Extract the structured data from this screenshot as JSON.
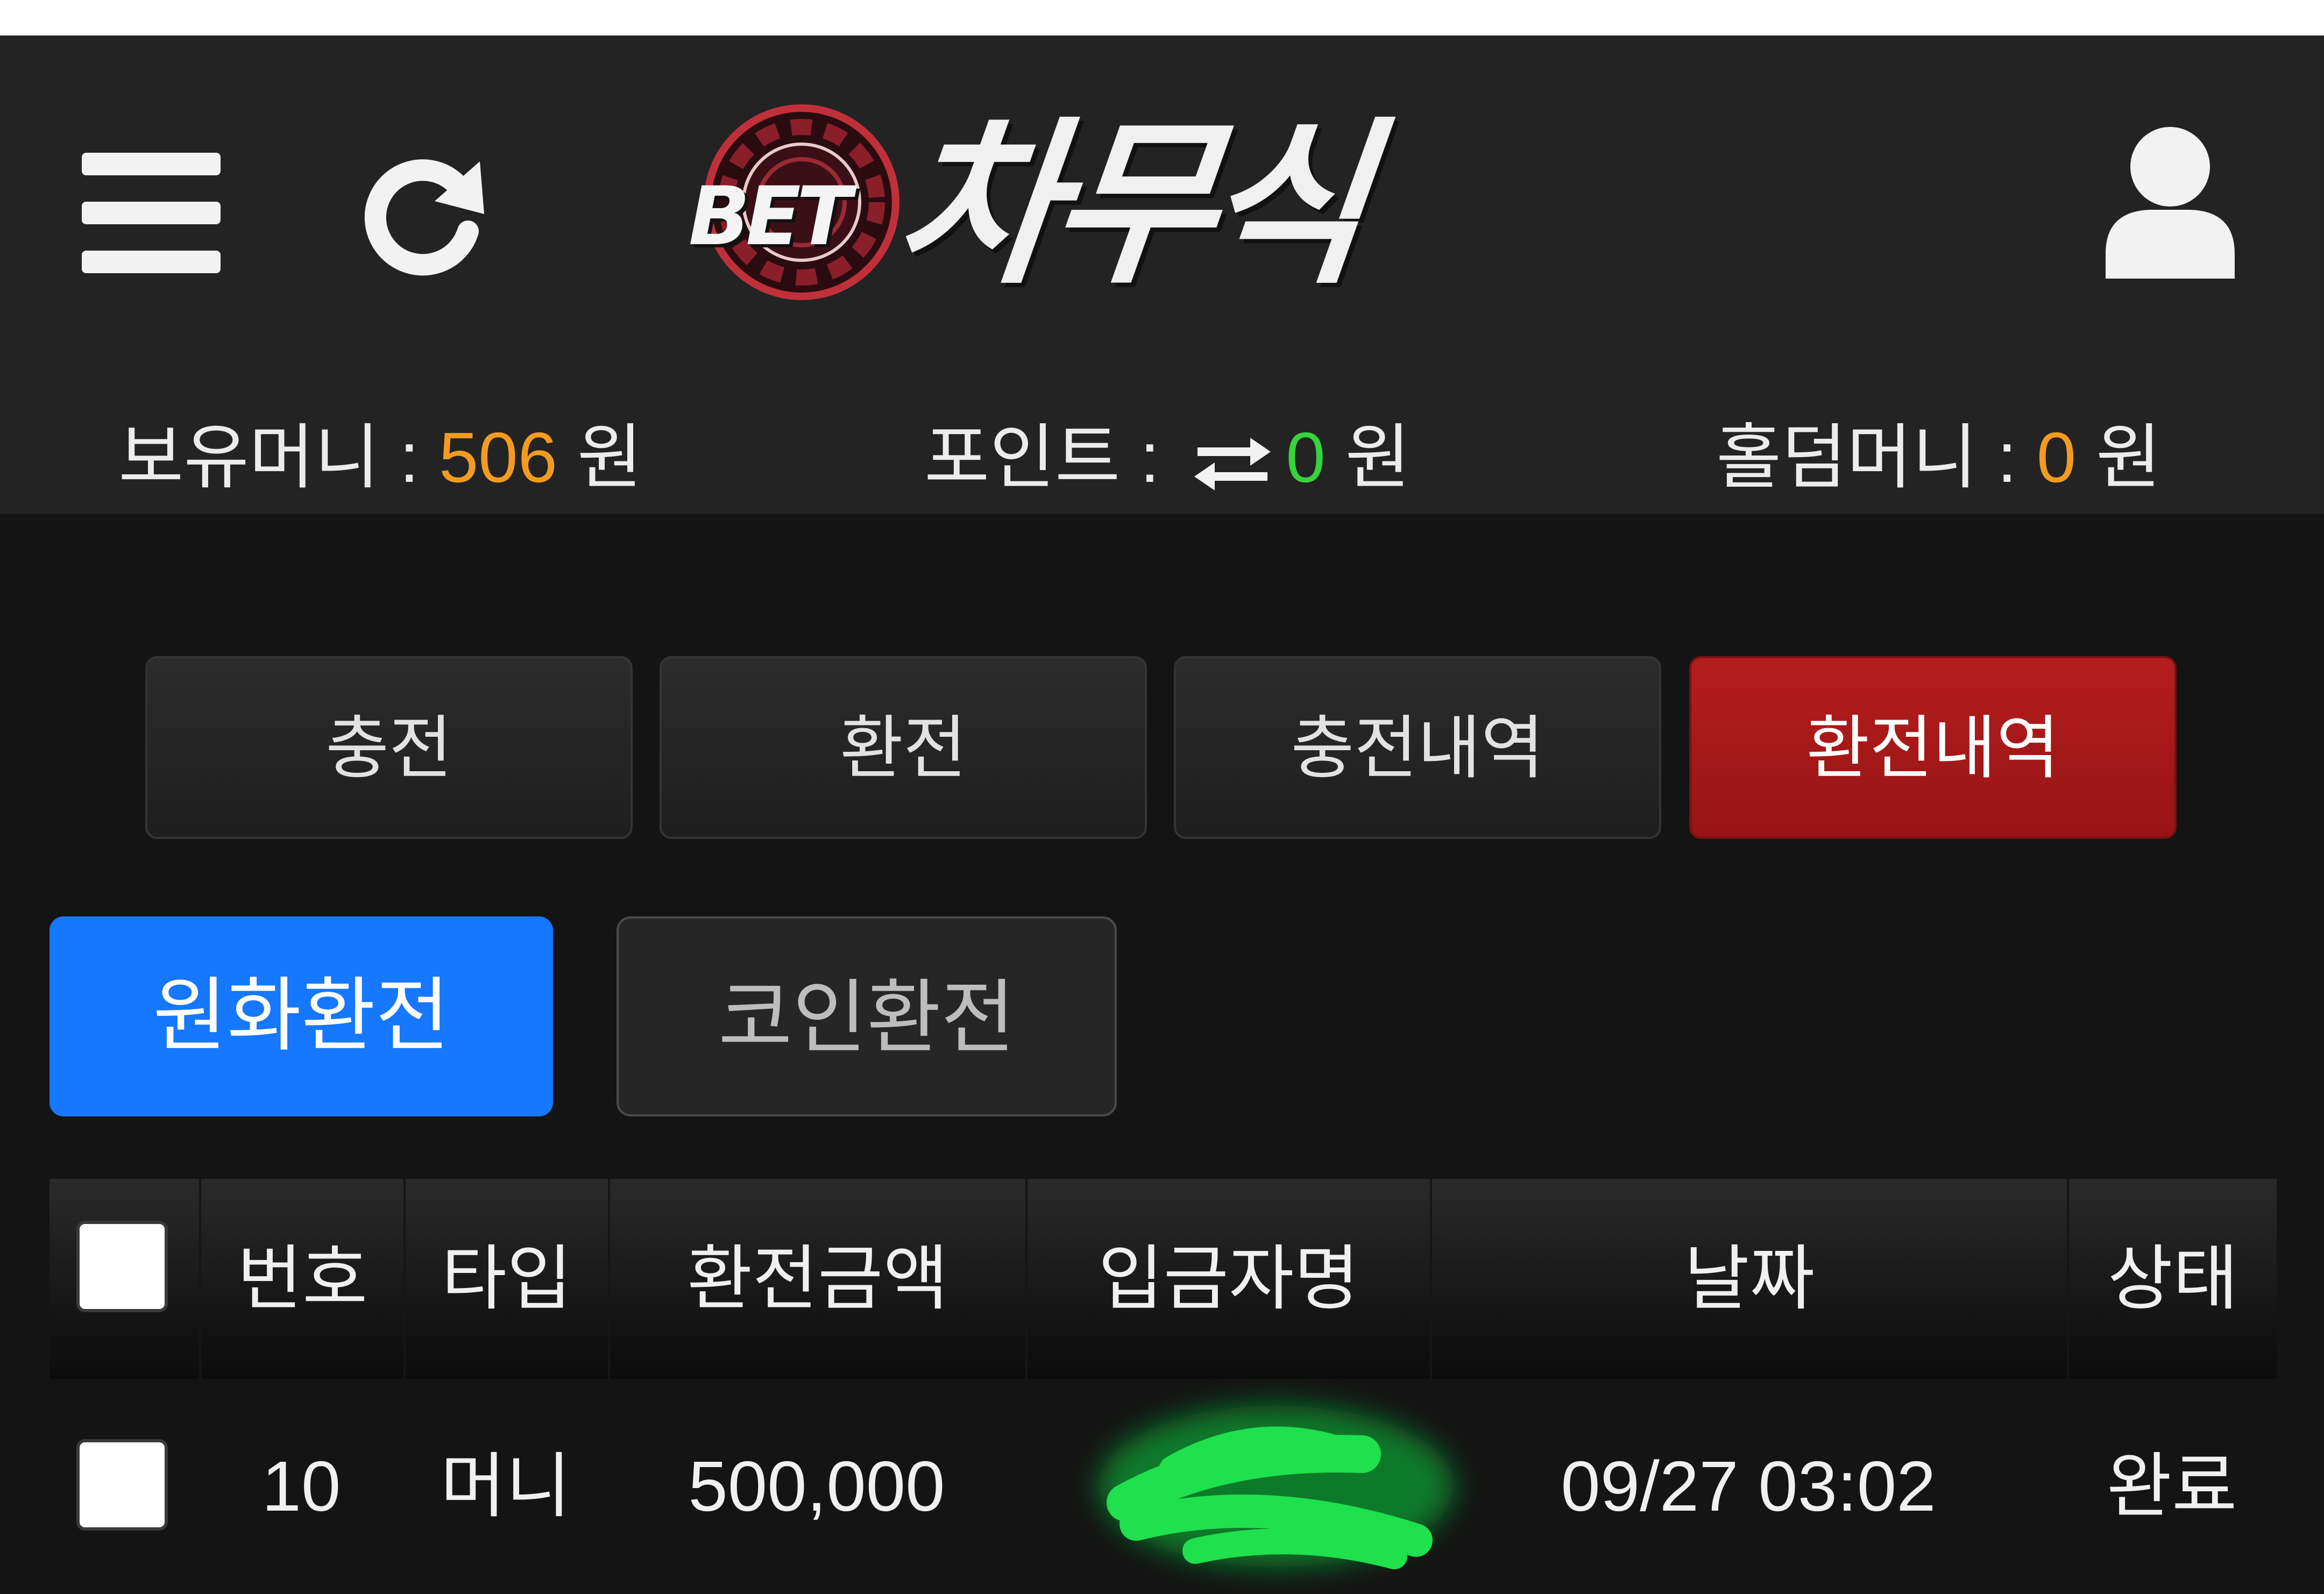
{
  "header": {
    "logo_prefix": "BET",
    "logo_text": "차무식"
  },
  "balance": {
    "money_label": "보유머니 : ",
    "money_value": "506",
    "money_unit": " 원",
    "point_label": "포인트 : ",
    "point_value": "0",
    "point_unit": " 원",
    "holdem_label": "홀덤머니 : ",
    "holdem_value": "0",
    "holdem_unit": " 원"
  },
  "tabs": [
    {
      "label": "충전"
    },
    {
      "label": "환전"
    },
    {
      "label": "충전내역"
    },
    {
      "label": "환전내역",
      "active": true
    }
  ],
  "subtabs": [
    {
      "label": "원화환전",
      "active": true
    },
    {
      "label": "코인환전"
    }
  ],
  "table": {
    "columns": [
      "번호",
      "타입",
      "환전금액",
      "입금자명",
      "날짜",
      "상태"
    ],
    "rows": [
      {
        "no": "10",
        "type": "머니",
        "amount": "500,000",
        "name": "",
        "date": "09/27 03:02",
        "status": "완료"
      }
    ]
  },
  "colors": {
    "accent_red": "#a71818",
    "accent_blue": "#1677ff",
    "money_orange": "#f39b21",
    "point_green": "#35d33c",
    "redaction_green": "#1fe04d"
  },
  "icons": {
    "menu": "menu-icon",
    "refresh": "refresh-icon",
    "user": "user-icon",
    "swap": "swap-arrows-icon"
  }
}
